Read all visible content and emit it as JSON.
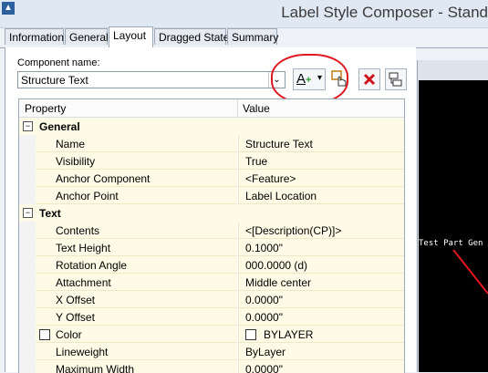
{
  "window": {
    "title": "Label Style Composer - Stand",
    "logo_glyph": "▲"
  },
  "tabs": [
    {
      "label": "Information",
      "active": false
    },
    {
      "label": "General",
      "active": false
    },
    {
      "label": "Layout",
      "active": true
    },
    {
      "label": "Dragged State",
      "active": false
    },
    {
      "label": "Summary",
      "active": false
    }
  ],
  "component": {
    "label": "Component name:",
    "selected": "Structure Text",
    "chevron": "⌄",
    "add_text_icon": "A+",
    "add_text_arrow": "▾"
  },
  "grid": {
    "header": {
      "property": "Property",
      "value": "Value"
    },
    "categories": [
      {
        "name": "General",
        "toggle": "⊟",
        "rows": [
          {
            "property": "Name",
            "value": "Structure Text"
          },
          {
            "property": "Visibility",
            "value": "True"
          },
          {
            "property": "Anchor Component",
            "value": "<Feature>"
          },
          {
            "property": "Anchor Point",
            "value": "Label Location"
          }
        ]
      },
      {
        "name": "Text",
        "toggle": "⊟",
        "rows": [
          {
            "property": "Contents",
            "value": "<[Description(CP)]>"
          },
          {
            "property": "Text Height",
            "value": "0.1000\""
          },
          {
            "property": "Rotation Angle",
            "value": "000.0000 (d)"
          },
          {
            "property": "Attachment",
            "value": "Middle center"
          },
          {
            "property": "X Offset",
            "value": "0.0000\""
          },
          {
            "property": "Y Offset",
            "value": "0.0000\""
          },
          {
            "property": "Color",
            "value": "BYLAYER"
          },
          {
            "property": "Lineweight",
            "value": "ByLayer"
          },
          {
            "property": "Maximum Width",
            "value": "0.0000\""
          }
        ]
      }
    ]
  },
  "preview": {
    "text": "Test Part Gen",
    "line_color": "#e0171f"
  },
  "colors": {
    "highlight_ring": "#e0171f",
    "row_bg": "#fdfbe6",
    "preview_bg": "#000000"
  }
}
